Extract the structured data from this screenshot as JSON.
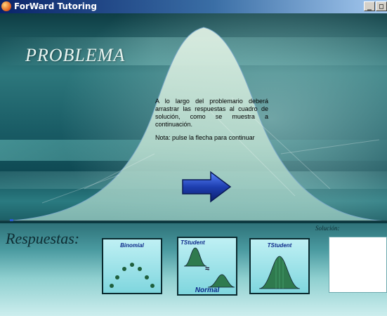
{
  "window": {
    "title": "ForWard Tutoring",
    "min_glyph": "_",
    "max_glyph": "□"
  },
  "main": {
    "heading": "PROBLEMA",
    "instructions": [
      "A lo largo del problemario deberá arrastrar las respuestas al cuadro de solución, como se muestra a continuación.",
      "Nota: pulse la flecha para continuar"
    ],
    "next_arrow_icon": "right-arrow-icon"
  },
  "panel": {
    "respuestas_label": "Respuestas:",
    "solucion_label": "Solución:",
    "cards": {
      "binomial": {
        "caption": "Binomial"
      },
      "tstudent_normal": {
        "top": "TStudent",
        "approx": "≈",
        "bottom": "Normal"
      },
      "tstudent": {
        "caption": "TStudent"
      }
    }
  },
  "colors": {
    "title_bar": "#0a246a",
    "arrow": "#1e3fb0",
    "card_border": "#0a2a2f",
    "card_caption": "#0d2a8a"
  }
}
